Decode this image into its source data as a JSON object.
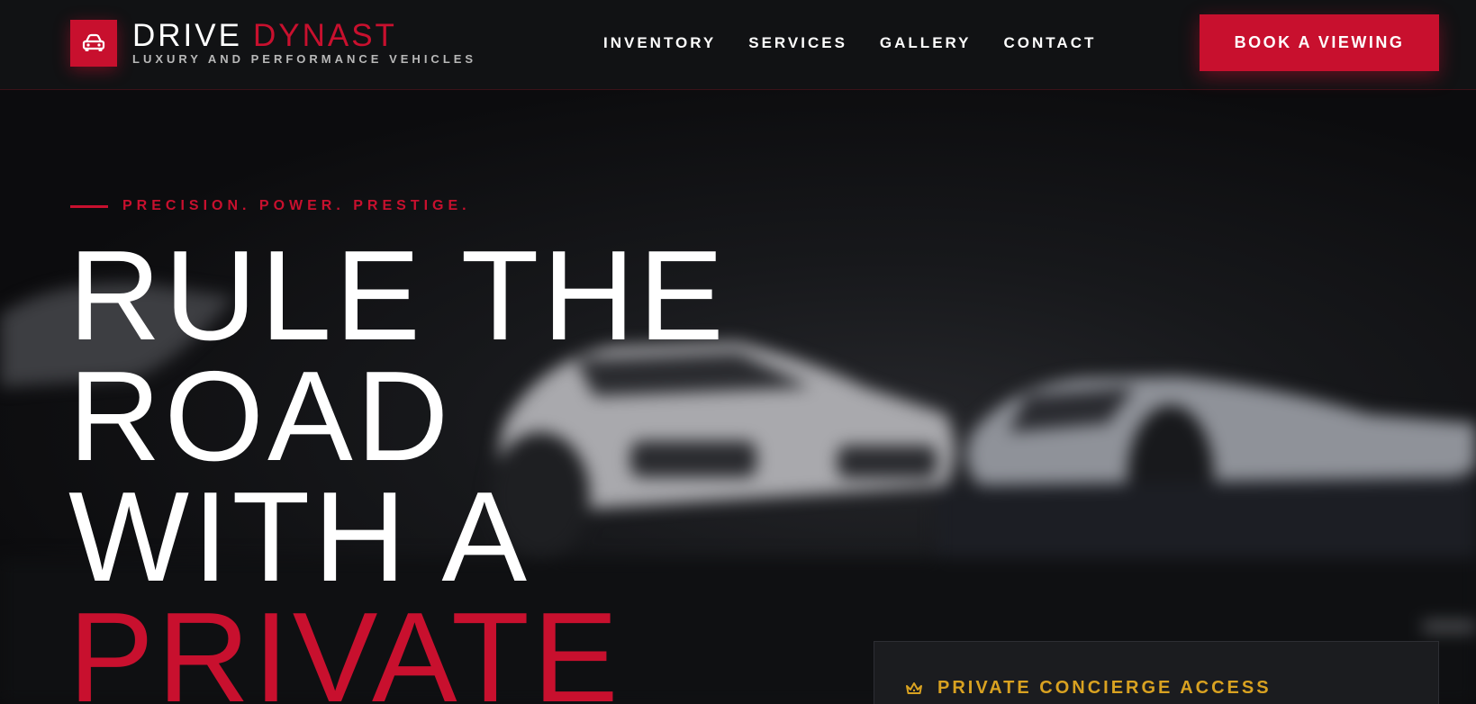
{
  "brand": {
    "name_part1": "DRIVE",
    "name_part2": "DYNAST",
    "tagline": "LUXURY AND PERFORMANCE VEHICLES",
    "logo_icon": "car-icon"
  },
  "nav": {
    "items": [
      {
        "label": "INVENTORY"
      },
      {
        "label": "SERVICES"
      },
      {
        "label": "GALLERY"
      },
      {
        "label": "CONTACT"
      }
    ]
  },
  "cta": {
    "label": "BOOK A VIEWING"
  },
  "hero": {
    "eyebrow": "PRECISION. POWER. PRESTIGE.",
    "headline_lines": [
      "RULE THE",
      "ROAD",
      "WITH A"
    ],
    "headline_accent": "PRIVATE"
  },
  "concierge": {
    "title": "PRIVATE CONCIERGE ACCESS",
    "icon": "crown-icon"
  },
  "colors": {
    "accent": "#c8102e",
    "gold": "#d9a221",
    "background": "#0b0b0d",
    "header": "#111214"
  }
}
